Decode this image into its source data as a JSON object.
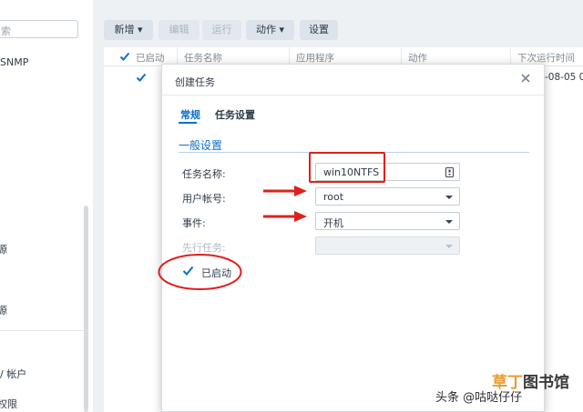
{
  "sidebar": {
    "search_placeholder": "索",
    "items": [
      {
        "label": "SNMP"
      },
      {
        "label": "源"
      },
      {
        "label": "源"
      },
      {
        "label": "/ 帐户"
      },
      {
        "label": "权限"
      }
    ]
  },
  "toolbar": {
    "add_label": "新增",
    "edit_label": "编辑",
    "run_label": "运行",
    "action_label": "动作",
    "settings_label": "设置"
  },
  "table": {
    "columns": [
      "已启动",
      "任务名称",
      "应用程序",
      "动作",
      "下次运行时间"
    ],
    "rows": [
      {
        "enabled": true,
        "next_run": "-08-05 0"
      }
    ]
  },
  "dialog": {
    "title": "创建任务",
    "tabs": [
      {
        "label": "常规",
        "active": true
      },
      {
        "label": "任务设置",
        "active": false
      }
    ],
    "section_title": "一般设置",
    "fields": {
      "task_name": {
        "label": "任务名称:",
        "value": "win10NTFS"
      },
      "user_account": {
        "label": "用户帐号:",
        "value": "root"
      },
      "event": {
        "label": "事件:",
        "value": "开机"
      },
      "prerequisite": {
        "label": "先行任务:",
        "value": ""
      }
    },
    "enabled_checkbox": {
      "label": "已启动",
      "checked": true
    }
  },
  "watermark": {
    "brand_a": "草丁",
    "brand_b": "图书馆",
    "credit": "头条 @咕哒仔仔"
  },
  "colors": {
    "accent": "#0b6fc9",
    "annotation_red": "#e0201c",
    "background": "#eef1f4"
  }
}
